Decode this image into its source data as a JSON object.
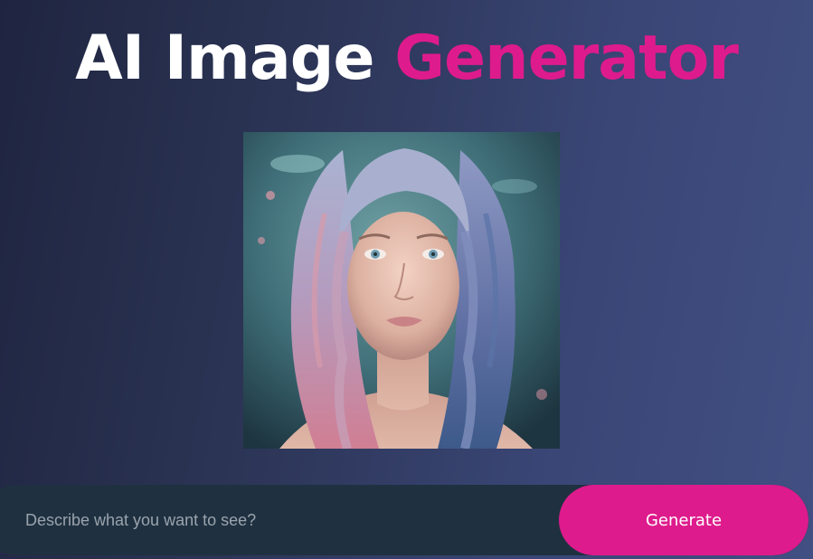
{
  "header": {
    "title_part1": "AI Image",
    "title_part2": "Generator"
  },
  "preview": {
    "image_alt": "Generated portrait of a young woman with long wavy silver-pink hair"
  },
  "prompt": {
    "placeholder": "Describe what you want to see?",
    "value": "",
    "button_label": "Generate"
  },
  "colors": {
    "accent": "#de1b8c",
    "background_start": "#1f2540",
    "background_end": "#414f82",
    "input_bar": "#1f3140"
  }
}
